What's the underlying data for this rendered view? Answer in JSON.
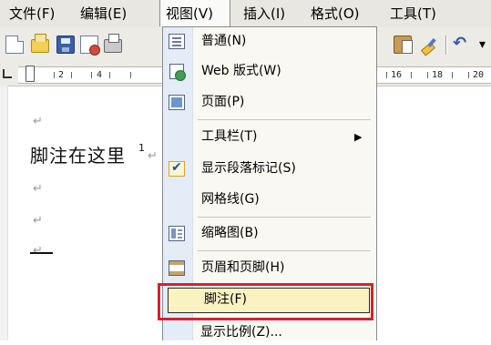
{
  "menubar": {
    "items": [
      "文件(F)",
      "编辑(E)",
      "视图(V)",
      "插入(I)",
      "格式(O)",
      "工具(T)"
    ]
  },
  "toolbar": {
    "undo_glyph": "↶",
    "more_glyph": "▾",
    "icons": [
      "new-document-icon",
      "open-folder-icon",
      "save-disk-icon",
      "permission-icon",
      "print-icon",
      "paste-icon",
      "format-painter-icon",
      "undo-icon",
      "overflow-icon"
    ]
  },
  "ruler": {
    "labels": [
      "1",
      "2",
      "1",
      "4",
      "1",
      "16",
      "1",
      "18",
      "1",
      "20"
    ]
  },
  "document": {
    "paragraph_mark": "↵",
    "body_text": "脚注在这里",
    "footnote_ref": "1"
  },
  "view_menu": {
    "items": [
      {
        "label": "普通(N)",
        "icon": "normal-view-icon"
      },
      {
        "label": "Web 版式(W)",
        "icon": "web-layout-icon"
      },
      {
        "label": "页面(P)",
        "icon": "page-layout-icon"
      },
      {
        "label": "工具栏(T)",
        "submenu_arrow": "▶"
      },
      {
        "label": "显示段落标记(S)",
        "icon": "checkmark-icon",
        "checked": true
      },
      {
        "label": "网格线(G)"
      },
      {
        "label": "缩略图(B)",
        "icon": "thumbnails-icon"
      },
      {
        "label": "页眉和页脚(H)",
        "icon": "header-footer-icon"
      },
      {
        "label": "脚注(F)",
        "highlighted": true
      },
      {
        "label": "显示比例(Z)..."
      }
    ]
  },
  "colors": {
    "highlight_frame": "#d7232a",
    "menu_background": "#f9f8f3",
    "hover_background": "#fbf2c2"
  }
}
